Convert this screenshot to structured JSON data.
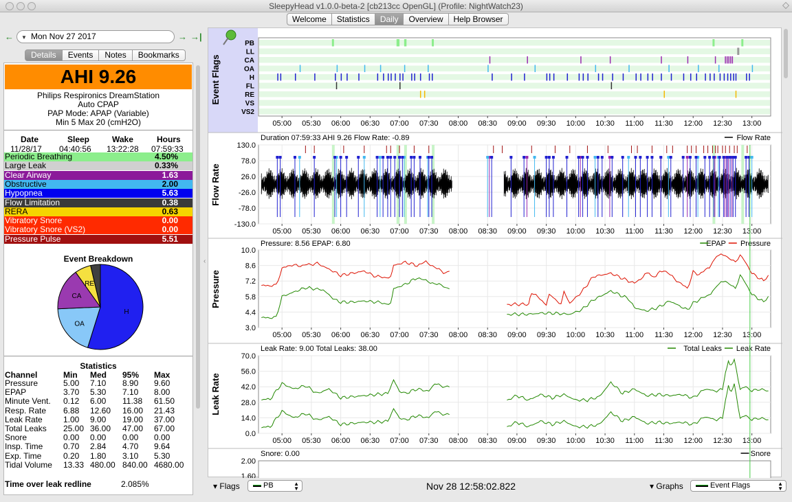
{
  "window": {
    "title": "SleepyHead v1.0.0-beta-2 [cb213cc OpenGL] (Profile: NightWatch23)"
  },
  "tabs": [
    {
      "label": "Welcome",
      "active": false
    },
    {
      "label": "Statistics",
      "active": false
    },
    {
      "label": "Daily",
      "active": true
    },
    {
      "label": "Overview",
      "active": false
    },
    {
      "label": "Help Browser",
      "active": false
    }
  ],
  "nav": {
    "prev": "←",
    "next": "→",
    "last": "→|",
    "date": "Mon Nov 27 2017"
  },
  "subtabs": [
    {
      "label": "Details",
      "active": true
    },
    {
      "label": "Events",
      "active": false
    },
    {
      "label": "Notes",
      "active": false
    },
    {
      "label": "Bookmarks",
      "active": false
    }
  ],
  "summary": {
    "ahi": "AHI 9.26",
    "machine": "Philips Respironics DreamStation",
    "mode_type": "Auto CPAP",
    "pap_mode": "PAP Mode: APAP (Variable)",
    "pressure_range": "Min 5 Max 20 (cmH2O)",
    "headers": [
      "Date",
      "Sleep",
      "Wake",
      "Hours"
    ],
    "values": [
      "11/28/17",
      "04:40:56",
      "13:22:28",
      "07:59:33"
    ]
  },
  "indices": [
    {
      "label": "Periodic Breathing",
      "value": "4.50%",
      "bg": "#8cee8c",
      "fg": "#000000"
    },
    {
      "label": "Large Leak",
      "value": "0.33%",
      "bg": "#d0d0d0",
      "fg": "#000000"
    },
    {
      "label": "Clear Airway",
      "value": "1.63",
      "bg": "#8b1a9a",
      "fg": "#ffffff"
    },
    {
      "label": "Obstructive",
      "value": "2.00",
      "bg": "#42b8f0",
      "fg": "#000000"
    },
    {
      "label": "Hypopnea",
      "value": "5.63",
      "bg": "#0000ee",
      "fg": "#ffffff"
    },
    {
      "label": "Flow Limitation",
      "value": "0.38",
      "bg": "#3a3a3a",
      "fg": "#ffffff"
    },
    {
      "label": "RERA",
      "value": "0.63",
      "bg": "#f5d400",
      "fg": "#000000"
    },
    {
      "label": "Vibratory Snore",
      "value": "0.00",
      "bg": "#ff2a00",
      "fg": "#ffffff"
    },
    {
      "label": "Vibratory Snore (VS2)",
      "value": "0.00",
      "bg": "#ff2a00",
      "fg": "#ffffff"
    },
    {
      "label": "Pressure Pulse",
      "value": "5.51",
      "bg": "#a01010",
      "fg": "#ffffff"
    }
  ],
  "breakdown": {
    "title": "Event Breakdown",
    "slices": [
      {
        "label": "H",
        "value": 5.63,
        "color": "#2020f0"
      },
      {
        "label": "OA",
        "value": 2.0,
        "color": "#88c8f8"
      },
      {
        "label": "CA",
        "value": 1.63,
        "color": "#9a3ab0"
      },
      {
        "label": "RE",
        "value": 0.63,
        "color": "#f5e040"
      },
      {
        "label": "",
        "value": 0.38,
        "color": "#404040"
      }
    ]
  },
  "statistics": {
    "title": "Statistics",
    "headers": [
      "Channel",
      "Min",
      "Med",
      "95%",
      "Max"
    ],
    "rows": [
      [
        "Pressure",
        "5.00",
        "7.10",
        "8.90",
        "9.60"
      ],
      [
        "EPAP",
        "3.70",
        "5.30",
        "7.10",
        "8.00"
      ],
      [
        "Minute Vent.",
        "0.12",
        "6.00",
        "11.38",
        "61.50"
      ],
      [
        "Resp. Rate",
        "6.88",
        "12.60",
        "16.00",
        "21.43"
      ],
      [
        "Leak Rate",
        "1.00",
        "9.00",
        "19.00",
        "37.00"
      ],
      [
        "Total Leaks",
        "25.00",
        "36.00",
        "47.00",
        "67.00"
      ],
      [
        "Snore",
        "0.00",
        "0.00",
        "0.00",
        "0.00"
      ],
      [
        "Insp. Time",
        "0.70",
        "2.84",
        "4.70",
        "9.64"
      ],
      [
        "Exp. Time",
        "0.20",
        "1.80",
        "3.10",
        "5.30"
      ],
      [
        "Tidal Volume",
        "13.33",
        "480.00",
        "840.00",
        "4680.00"
      ]
    ],
    "leak_redline_label": "Time over leak redline",
    "leak_redline_value": "2.085%"
  },
  "time_ticks": [
    "05:00",
    "05:30",
    "06:00",
    "06:30",
    "07:00",
    "07:30",
    "08:00",
    "08:30",
    "09:00",
    "09:30",
    "10:00",
    "10:30",
    "11:00",
    "11:30",
    "12:00",
    "12:30",
    "13:00"
  ],
  "chart_data": [
    {
      "type": "event_flags",
      "ylabel": "Event Flags",
      "rows": [
        "PB",
        "LL",
        "CA",
        "OA",
        "H",
        "FL",
        "RE",
        "VS",
        "VS2"
      ],
      "events": {
        "PB": [
          [
            5.85,
            5.88
          ],
          [
            6.95,
            7.0
          ],
          [
            7.08,
            7.12
          ],
          [
            7.55,
            7.58
          ],
          [
            12.33,
            12.36
          ],
          [
            12.82,
            12.84
          ]
        ],
        "LL": [
          [
            12.75,
            12.77
          ]
        ],
        "CA": [
          8.53,
          9.17,
          10.08,
          10.58,
          11.45,
          11.9,
          12.37,
          12.54,
          12.57,
          12.6,
          12.63,
          12.66
        ],
        "OA": [
          5.3,
          5.93,
          6.4,
          6.67,
          7.08,
          7.48,
          8.5,
          9.3,
          10.33,
          10.9,
          11.58,
          12.08,
          12.43,
          13.0
        ],
        "H": [
          4.92,
          4.97,
          5.22,
          5.55,
          5.9,
          6.0,
          6.1,
          6.3,
          6.62,
          6.72,
          6.8,
          6.85,
          6.92,
          7.0,
          7.05,
          7.2,
          7.25,
          7.35,
          7.5,
          7.55,
          8.57,
          8.9,
          9.12,
          9.5,
          9.55,
          9.62,
          9.85,
          10.05,
          10.12,
          10.2,
          10.38,
          10.45,
          10.62,
          10.8,
          11.02,
          11.1,
          11.22,
          11.3,
          11.45,
          11.62,
          11.83,
          11.95,
          12.05,
          12.2,
          12.28,
          12.35,
          12.45,
          12.52,
          12.58,
          12.63,
          12.68,
          12.72,
          12.9,
          12.95
        ],
        "FL": [
          5.92,
          7.0,
          10.6
        ],
        "RE": [
          7.35,
          7.42,
          11.5,
          12.72
        ]
      }
    },
    {
      "type": "line",
      "ylabel": "Flow Rate",
      "header_text": "Duration 07:59:33 AHI 9.26 Flow Rate: -0.89",
      "series": [
        {
          "name": "Flow Rate",
          "color": "#000000"
        }
      ],
      "y_ticks": [
        "130.0",
        "78.0",
        "26.0",
        "-26.0",
        "-78.0",
        "-130.0"
      ],
      "ylim": [
        -130,
        130
      ],
      "gap": [
        7.9,
        8.78
      ],
      "pressure_pulses": [
        5.4,
        5.55,
        6.05,
        6.4,
        6.78,
        6.85,
        7.0,
        7.25,
        7.5,
        8.6,
        8.75,
        9.25,
        9.65,
        9.9,
        10.2,
        10.55,
        10.95,
        11.05,
        11.3,
        11.55,
        11.65,
        11.9,
        11.97,
        12.05,
        12.18,
        12.25,
        12.33,
        12.38,
        12.42,
        12.5,
        12.55,
        12.62,
        12.7,
        12.75,
        12.92
      ],
      "markers": [
        5.4,
        5.9,
        6.1,
        6.5,
        6.7,
        7.0,
        7.2,
        7.4,
        8.6,
        9.3,
        9.6,
        10.0,
        10.4,
        10.9,
        11.1,
        11.4,
        11.7,
        12.0,
        12.3,
        12.5,
        12.7
      ]
    },
    {
      "type": "line",
      "ylabel": "Pressure",
      "header_text": "Pressure: 8.56 EPAP: 6.80",
      "y_ticks": [
        "10.0",
        "8.6",
        "7.2",
        "5.8",
        "4.4",
        "3.0"
      ],
      "ylim": [
        3.0,
        10.0
      ],
      "series": [
        {
          "name": "Pressure",
          "color": "#dd1100",
          "x": [
            4.65,
            4.9,
            5.0,
            5.1,
            5.35,
            5.6,
            5.9,
            6.0,
            6.2,
            6.4,
            6.6,
            6.85,
            6.9,
            7.1,
            7.3,
            7.45,
            7.6,
            7.75,
            7.85,
            8.83,
            8.9,
            9.0,
            9.1,
            9.2,
            9.25,
            9.5,
            9.55,
            9.75,
            9.8,
            9.9,
            10.1,
            10.3,
            10.6,
            10.9,
            11.0,
            11.25,
            11.3,
            11.5,
            11.9,
            12.0,
            12.1,
            12.25,
            12.3,
            12.4,
            12.55,
            12.65,
            12.72,
            12.8,
            12.9,
            13.0,
            13.2,
            13.28
          ],
          "y": [
            6.8,
            6.8,
            8.3,
            8.6,
            8.6,
            8.8,
            8.0,
            7.7,
            7.9,
            8.1,
            7.6,
            7.5,
            8.6,
            8.9,
            8.6,
            8.9,
            8.5,
            7.9,
            8.1,
            5.1,
            5.1,
            5.1,
            5.1,
            5.1,
            6.2,
            5.1,
            6.0,
            5.1,
            6.2,
            5.2,
            6.2,
            7.6,
            7.9,
            7.2,
            7.0,
            8.0,
            7.5,
            8.2,
            6.5,
            8.0,
            7.8,
            8.3,
            8.6,
            9.5,
            9.5,
            9.1,
            8.9,
            9.6,
            8.8,
            7.9,
            7.2,
            7.7
          ]
        },
        {
          "name": "EPAP",
          "color": "#228800",
          "x": [
            4.65,
            4.9,
            5.0,
            5.2,
            5.4,
            5.7,
            5.9,
            6.0,
            6.2,
            6.4,
            6.6,
            6.85,
            6.9,
            7.1,
            7.3,
            7.45,
            7.6,
            7.75,
            7.85,
            8.83,
            9.0,
            9.2,
            9.4,
            9.6,
            9.9,
            10.1,
            10.3,
            10.6,
            10.9,
            11.0,
            11.2,
            11.4,
            11.6,
            11.9,
            12.0,
            12.2,
            12.3,
            12.4,
            12.55,
            12.65,
            12.72,
            12.8,
            12.9,
            13.0,
            13.2,
            13.28
          ],
          "y": [
            3.9,
            3.9,
            5.8,
            6.2,
            6.6,
            6.4,
            5.5,
            5.3,
            5.3,
            5.4,
            5.3,
            5.1,
            6.5,
            6.9,
            7.5,
            7.2,
            7.0,
            6.7,
            6.5,
            4.2,
            4.2,
            4.2,
            4.3,
            4.3,
            4.2,
            4.6,
            5.5,
            6.3,
            5.6,
            4.8,
            4.5,
            4.8,
            5.4,
            4.6,
            5.2,
            5.8,
            6.0,
            6.8,
            7.2,
            6.8,
            6.5,
            7.8,
            6.9,
            6.0,
            5.3,
            5.8
          ]
        }
      ]
    },
    {
      "type": "line",
      "ylabel": "Leak Rate",
      "header_text": "Leak Rate: 9.00 Total Leaks: 38.00",
      "y_ticks": [
        "70.0",
        "56.0",
        "42.0",
        "28.0",
        "14.0",
        "0.0"
      ],
      "ylim": [
        0,
        70
      ],
      "series": [
        {
          "name": "Total Leaks",
          "color": "#228800",
          "x": [
            4.65,
            4.8,
            5.0,
            5.2,
            5.4,
            5.6,
            5.8,
            6.0,
            6.2,
            6.4,
            6.6,
            6.8,
            6.9,
            7.0,
            7.1,
            7.3,
            7.5,
            7.6,
            7.7,
            7.85,
            8.83,
            9.0,
            9.2,
            9.4,
            9.6,
            9.8,
            10.0,
            10.2,
            10.4,
            10.6,
            10.8,
            11.0,
            11.2,
            11.4,
            11.6,
            11.8,
            12.0,
            12.2,
            12.4,
            12.5,
            12.55,
            12.6,
            12.65,
            12.7,
            12.8,
            12.9,
            13.0,
            13.1,
            13.28
          ],
          "y": [
            30,
            31,
            45,
            40,
            43,
            36,
            40,
            32,
            33,
            34,
            35,
            36,
            48,
            38,
            36,
            40,
            38,
            45,
            43,
            42,
            30,
            34,
            30,
            35,
            32,
            35,
            30,
            30,
            33,
            46,
            36,
            40,
            34,
            35,
            34,
            35,
            32,
            40,
            38,
            40,
            55,
            64,
            62,
            66,
            40,
            42,
            38,
            40,
            38
          ]
        },
        {
          "name": "Leak Rate",
          "color": "#228800",
          "x": [
            4.65,
            4.8,
            5.0,
            5.2,
            5.4,
            5.6,
            5.8,
            6.0,
            6.2,
            6.4,
            6.6,
            6.8,
            6.9,
            7.0,
            7.1,
            7.3,
            7.5,
            7.6,
            7.7,
            7.85,
            8.83,
            9.0,
            9.2,
            9.4,
            9.6,
            9.8,
            10.0,
            10.2,
            10.4,
            10.6,
            10.8,
            11.0,
            11.2,
            11.4,
            11.6,
            11.8,
            12.0,
            12.2,
            12.4,
            12.5,
            12.55,
            12.6,
            12.65,
            12.7,
            12.8,
            12.9,
            13.0,
            13.1,
            13.28
          ],
          "y": [
            5,
            6,
            20,
            14,
            18,
            12,
            15,
            8,
            9,
            10,
            10,
            11,
            22,
            14,
            12,
            16,
            14,
            20,
            18,
            17,
            6,
            10,
            6,
            11,
            8,
            11,
            6,
            6,
            8,
            19,
            11,
            15,
            9,
            10,
            9,
            10,
            8,
            15,
            12,
            14,
            30,
            42,
            38,
            44,
            14,
            16,
            12,
            14,
            12
          ]
        }
      ]
    },
    {
      "type": "line",
      "ylabel": "",
      "header_text": "Snore: 0.00",
      "series": [
        {
          "name": "Snore",
          "color": "#000000"
        }
      ],
      "y_ticks": [
        "2.00",
        "1.60"
      ]
    }
  ],
  "bottom": {
    "flags_label": "Flags",
    "flags_value": "PB",
    "time": "Nov 28 12:58:02.822",
    "graphs_label": "Graphs",
    "graphs_value": "Event Flags"
  },
  "colors": {
    "event_panel_bg": "#d8d8f8",
    "row_band": "#e4f8e4",
    "cursor": "#44cc44"
  }
}
